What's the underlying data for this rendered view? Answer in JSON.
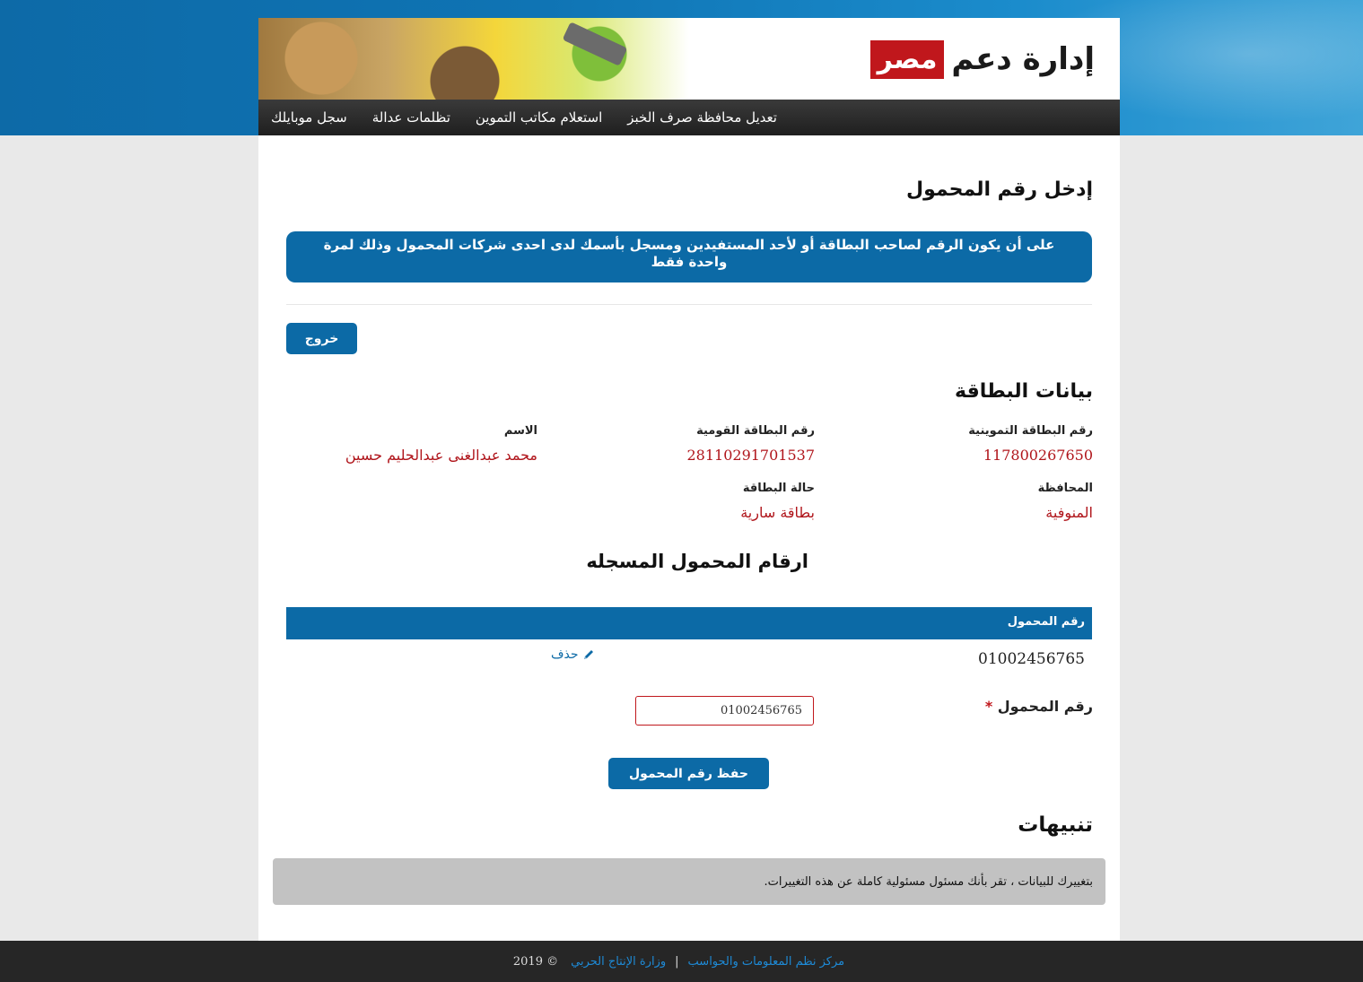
{
  "header": {
    "logo_text": "إدارة دعم",
    "logo_highlight": "مصر",
    "nav": [
      {
        "label": "سجل موبايلك"
      },
      {
        "label": "تظلمات عدالة"
      },
      {
        "label": "استعلام مكاتب التموين"
      },
      {
        "label": "تعديل محافظة صرف الخبز"
      }
    ]
  },
  "page": {
    "title": "إدخل رقم المحمول",
    "notice": "على أن يكون الرقم لصاحب البطاقة أو لأحد المستفيدين ومسجل بأسمك لدى احدى شركات المحمول وذلك لمرة واحدة فقط",
    "exit_label": "خروج"
  },
  "card": {
    "section_title": "بيانات البطاقة",
    "ration_card_label": "رقم البطاقة التموينية",
    "ration_card_value": "117800267650",
    "national_id_label": "رقم البطاقة القومية",
    "national_id_value": "28110291701537",
    "name_label": "الاسم",
    "name_value": "محمد عبدالغنى عبدالحليم حسين",
    "governorate_label": "المحافظة",
    "governorate_value": "المنوفية",
    "status_label": "حالة البطاقة",
    "status_value": "بطاقة سارية"
  },
  "mobiles": {
    "section_title": "ارقام المحمول المسجله",
    "column_header": "رقم المحمول",
    "rows": [
      {
        "number": "01002456765",
        "delete_label": "حذف"
      }
    ]
  },
  "form": {
    "mobile_label": "رقم المحمول",
    "required_mark": "*",
    "mobile_value": "01002456765",
    "save_label": "حفظ رقم المحمول"
  },
  "alerts": {
    "title": "تنبيهات",
    "message": "بتغييرك للبيانات ، تقر بأنك مسئول مسئولية كاملة عن هذه التغييرات."
  },
  "footer": {
    "link1": "مركز نظم المعلومات والحواسب",
    "separator": "|",
    "link2": "وزارة الإنتاج الحربي",
    "copyright": "© 2019"
  },
  "colors": {
    "primary": "#0c6aa6",
    "danger": "#b0151b",
    "navbar": "#262626"
  }
}
